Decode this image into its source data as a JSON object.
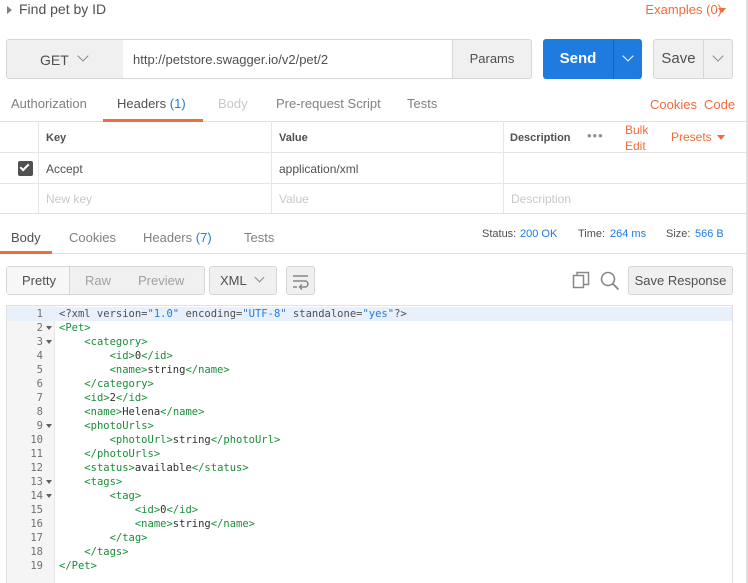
{
  "request": {
    "title": "Find pet by ID",
    "examples_label": "Examples (0)",
    "method": "GET",
    "url": "http://petstore.swagger.io/v2/pet/2",
    "params_label": "Params",
    "send_label": "Send",
    "save_label": "Save"
  },
  "request_tabs": {
    "authorization": "Authorization",
    "headers": "Headers",
    "headers_count": "(1)",
    "body": "Body",
    "pre_request": "Pre-request Script",
    "tests": "Tests",
    "cookies": "Cookies",
    "code": "Code"
  },
  "headers_table": {
    "col_key": "Key",
    "col_value": "Value",
    "col_description": "Description",
    "more": "•••",
    "bulk_edit_line1": "Bulk",
    "bulk_edit_line2": "Edit",
    "presets": "Presets",
    "rows": [
      {
        "checked": true,
        "key": "Accept",
        "value": "application/xml",
        "description": ""
      }
    ],
    "placeholder_key": "New key",
    "placeholder_value": "Value",
    "placeholder_description": "Description"
  },
  "response_tabs": {
    "body": "Body",
    "cookies": "Cookies",
    "headers": "Headers",
    "headers_count": "(7)",
    "tests": "Tests",
    "status_label": "Status:",
    "status_value": "200 OK",
    "time_label": "Time:",
    "time_value": "264 ms",
    "size_label": "Size:",
    "size_value": "566 B"
  },
  "response_toolbar": {
    "pretty": "Pretty",
    "raw": "Raw",
    "preview": "Preview",
    "format": "XML",
    "save_response": "Save Response",
    "icons": [
      "wrap-lines-icon",
      "copy-icon",
      "search-icon"
    ]
  },
  "response_body": {
    "lines": [
      {
        "n": "1",
        "text": "<?xml version=\"1.0\" encoding=\"UTF-8\" standalone=\"yes\"?>"
      },
      {
        "n": "2",
        "text": "<Pet>"
      },
      {
        "n": "3",
        "text": "    <category>"
      },
      {
        "n": "4",
        "text": "        <id>0</id>"
      },
      {
        "n": "5",
        "text": "        <name>string</name>"
      },
      {
        "n": "6",
        "text": "    </category>"
      },
      {
        "n": "7",
        "text": "    <id>2</id>"
      },
      {
        "n": "8",
        "text": "    <name>Helena</name>"
      },
      {
        "n": "9",
        "text": "    <photoUrls>"
      },
      {
        "n": "10",
        "text": "        <photoUrl>string</photoUrl>"
      },
      {
        "n": "11",
        "text": "    </photoUrls>"
      },
      {
        "n": "12",
        "text": "    <status>available</status>"
      },
      {
        "n": "13",
        "text": "    <tags>"
      },
      {
        "n": "14",
        "text": "        <tag>"
      },
      {
        "n": "15",
        "text": "            <id>0</id>"
      },
      {
        "n": "16",
        "text": "            <name>string</name>"
      },
      {
        "n": "17",
        "text": "        </tag>"
      },
      {
        "n": "18",
        "text": "    </tags>"
      },
      {
        "n": "19",
        "text": "</Pet>"
      }
    ]
  },
  "colors": {
    "accent_orange": "#f26b3a",
    "accent_blue": "#1f7be0",
    "xml_tag": "#1a8c3a"
  }
}
